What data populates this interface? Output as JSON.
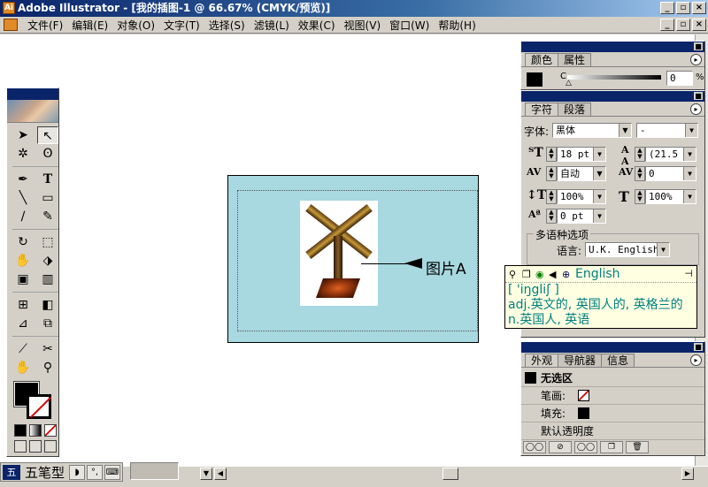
{
  "window": {
    "title": "Adobe Illustrator - [我的插图-1 @ 66.67% (CMYK/预览)]"
  },
  "menu": [
    "文件(F)",
    "编辑(E)",
    "对象(O)",
    "文字(T)",
    "选择(S)",
    "滤镜(L)",
    "效果(C)",
    "视图(V)",
    "窗口(W)",
    "帮助(H)"
  ],
  "canvas": {
    "label": "图片A"
  },
  "color_panel": {
    "tabs": [
      "颜色",
      "属性"
    ],
    "channel_label": "C",
    "value": "0",
    "unit": "%"
  },
  "char_panel": {
    "tabs": [
      "字符",
      "段落"
    ],
    "font_label": "字体:",
    "font_value": "黑体",
    "font_style": "-",
    "size": "18 pt",
    "leading": "(21.5",
    "kerning": "自动",
    "tracking": "0",
    "vscale": "100%",
    "hscale": "100%",
    "baseline": "0 pt",
    "multilang_title": "多语种选项",
    "language_label": "语言:",
    "language_value": "U.K. English"
  },
  "tooltip": {
    "word": "English",
    "phonetic": "[ 'iŋgliʃ ]",
    "adj": "adj.英文的, 英国人的, 英格兰的",
    "noun": "n.英国人, 英语"
  },
  "appearance_panel": {
    "tabs": [
      "外观",
      "导航器",
      "信息"
    ],
    "selection": "无选区",
    "stroke_label": "笔画:",
    "fill_label": "填充:",
    "opacity_label": "默认透明度"
  },
  "statusbar": {
    "ime_name": "五笔型"
  },
  "colors": {
    "title_bar": "#0a246a",
    "artboard": "#a8d8e0",
    "tooltip_bg": "#ffffe1",
    "tooltip_text": "#008080"
  }
}
